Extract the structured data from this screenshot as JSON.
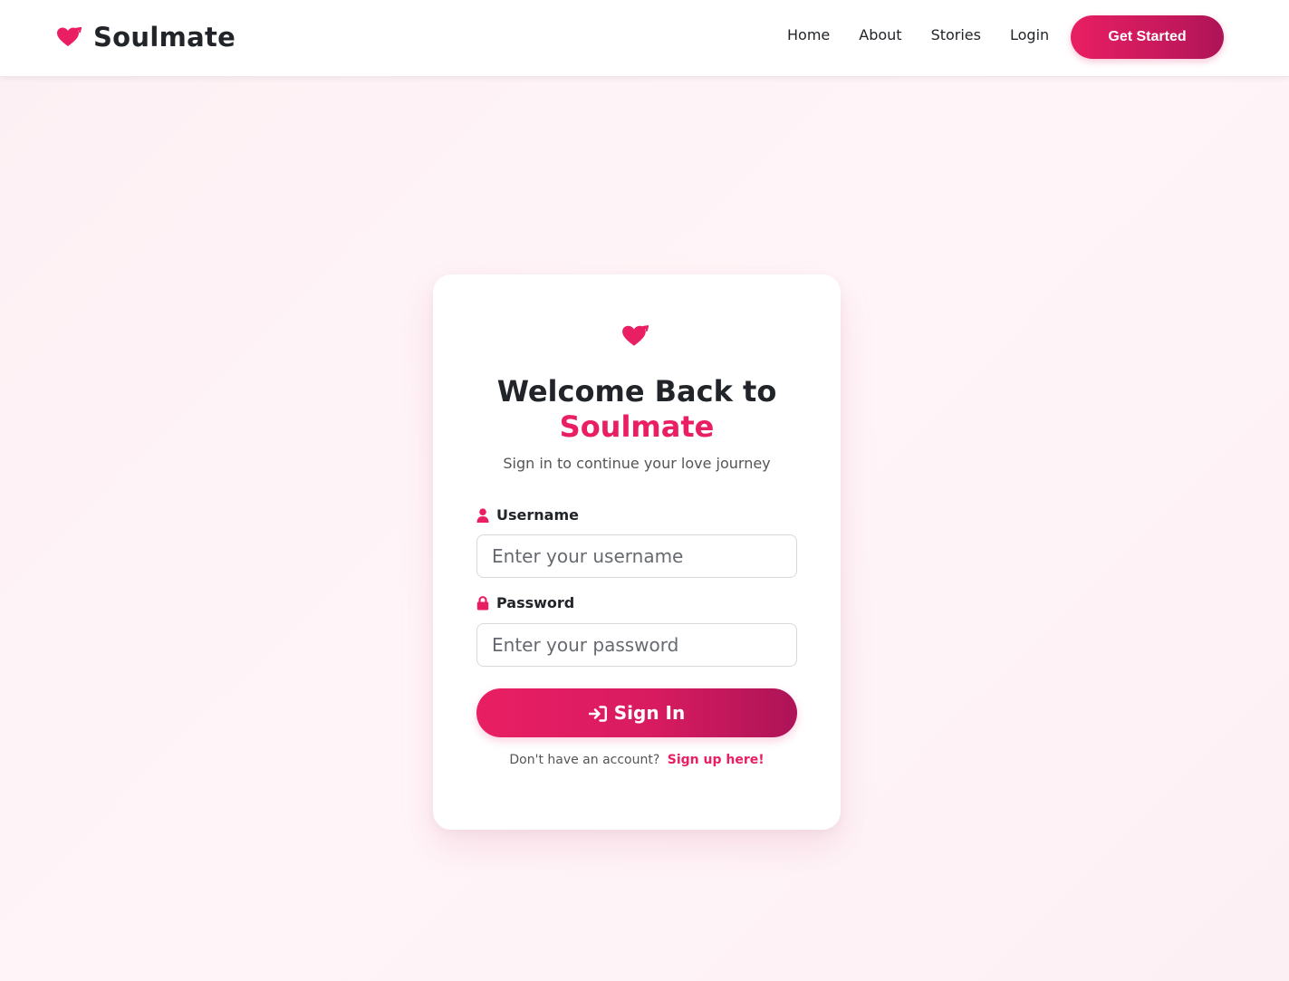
{
  "brand": {
    "name": "Soulmate",
    "icon": "heart-arrow-icon",
    "color": "#e91e63"
  },
  "nav": {
    "items": [
      {
        "label": "Home"
      },
      {
        "label": "About"
      },
      {
        "label": "Stories"
      },
      {
        "label": "Login"
      }
    ],
    "cta_label": "Get Started"
  },
  "login": {
    "icon": "heart-arrow-icon",
    "title_line1": "Welcome Back to",
    "title_line2": "Soulmate",
    "subtitle": "Sign in to continue your love journey",
    "username": {
      "label": "Username",
      "icon": "user-icon",
      "placeholder": "Enter your username",
      "value": ""
    },
    "password": {
      "label": "Password",
      "icon": "lock-icon",
      "placeholder": "Enter your password",
      "value": ""
    },
    "submit_label": "Sign In",
    "submit_icon": "sign-in-icon",
    "signup_prompt": "Don't have an account?",
    "signup_link": "Sign up here!"
  },
  "colors": {
    "accent": "#e91e63",
    "accent_dark": "#ad1457",
    "text": "#212529",
    "muted": "#555555",
    "background": "#fdf0f4"
  }
}
